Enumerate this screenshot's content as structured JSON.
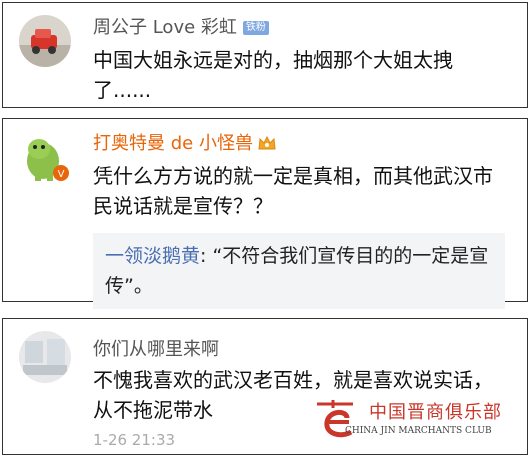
{
  "comments": [
    {
      "username": "周公子 Love 彩虹",
      "badge": "铁粉",
      "text": "中国大姐永远是对的，抽烟那个大姐太拽了......"
    },
    {
      "username": "打奥特曼 de 小怪兽",
      "text": "凭什么方方说的就一定是真相，而其他武汉市民说话就是宣传？？",
      "reply_author": "一领淡鹅黄",
      "reply_text": ": “不符合我们宣传目的的一定是宣传”。"
    },
    {
      "username": "你们从哪里来啊",
      "text": "不愧我喜欢的武汉老百姓，就是喜欢说实话，从不拖泥带水",
      "time": "1-26 21:33"
    }
  ],
  "watermark": {
    "cn": "中国晋商俱乐部",
    "en": "CHINA JIN MARCHANTS CLUB"
  },
  "colors": {
    "orange_name": "#e8650a",
    "reply_name": "#4a6fb0",
    "watermark_red": "#c9372b"
  }
}
